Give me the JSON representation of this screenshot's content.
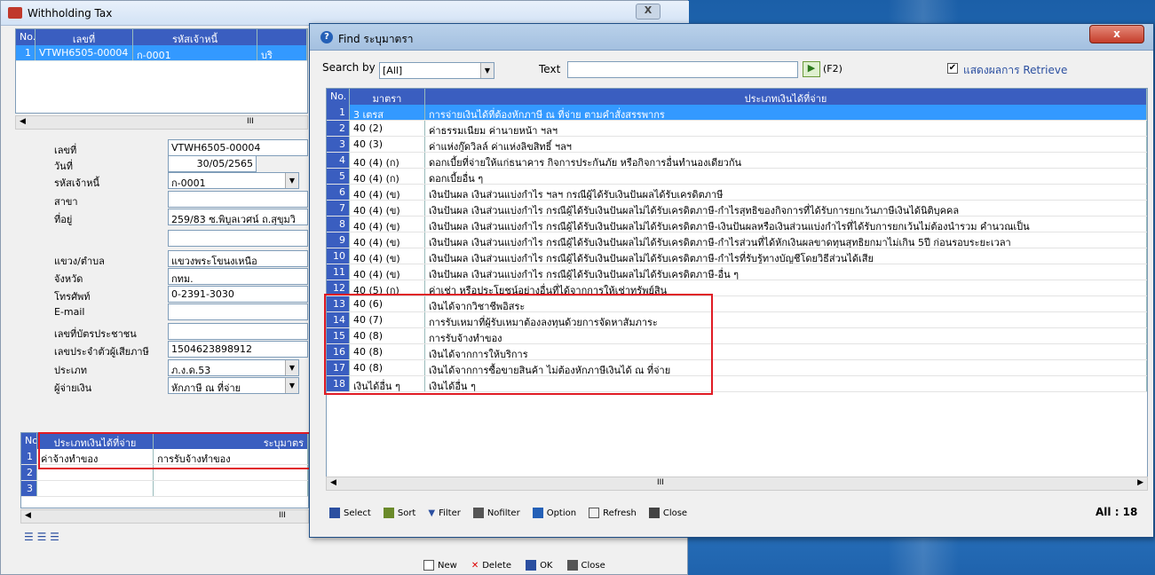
{
  "back": {
    "title": "Withholding Tax",
    "close": "X",
    "list_headers": {
      "no": "No.",
      "doc": "เลขที่",
      "creditor": "รหัสเจ้าหนี้"
    },
    "list_row": {
      "no": "1",
      "doc": "VTWH6505-00004",
      "creditor": "ก-0001",
      "extra": "บริ"
    },
    "scroll_mark": "III",
    "fields": [
      {
        "label": "เลขที่",
        "value": "VTWH6505-00004"
      },
      {
        "label": "วันที่",
        "value": "30/05/2565"
      },
      {
        "label": "รหัสเจ้าหนี้",
        "value": "ก-0001"
      },
      {
        "label": "สาขา",
        "value": ""
      },
      {
        "label": "ที่อยู่",
        "value": "259/83 ซ.พิบูลเวศน์ ถ.สุขุมวิ"
      },
      {
        "label": "",
        "value": ""
      },
      {
        "label": "แขวง/ตำบล",
        "value": "แขวงพระโขนงเหนือ"
      },
      {
        "label": "จังหวัด",
        "value": "กทม."
      },
      {
        "label": "โทรศัพท์",
        "value": "0-2391-3030"
      },
      {
        "label": "E-mail",
        "value": ""
      },
      {
        "label": "เลขที่บัตรประชาชน",
        "value": ""
      },
      {
        "label": "เลขประจำตัวผู้เสียภาษี",
        "value": "1504623898912"
      },
      {
        "label": "ประเภท",
        "value": "ภ.ง.ด.53"
      },
      {
        "label": "ผู้จ่ายเงิน",
        "value": "หักภาษี ณ ที่จ่าย"
      }
    ],
    "detail_headers": {
      "no": "No.",
      "type": "ประเภทเงินได้ที่จ่าย",
      "section": "ระบุมาตร"
    },
    "detail_rows": [
      {
        "no": "1",
        "type": "ค่าจ้างทำของ",
        "section": "การรับจ้างทำของ"
      },
      {
        "no": "2",
        "type": "",
        "section": ""
      },
      {
        "no": "3",
        "type": "",
        "section": ""
      }
    ],
    "bottom_buttons": {
      "new": "New",
      "delete": "Delete",
      "ok": "OK",
      "close": "Close"
    }
  },
  "find": {
    "title": "Find ระบุมาตรา",
    "close": "x",
    "search_by_label": "Search by",
    "search_by_value": "[All]",
    "text_label": "Text",
    "text_value": "",
    "f2": "(F2)",
    "retrieve_label": "แสดงผลการ Retrieve",
    "headers": {
      "no": "No.",
      "section": "มาตรา",
      "type": "ประเภทเงินได้ที่จ่าย"
    },
    "rows": [
      {
        "no": "1",
        "section": "3 เตรส",
        "type": "การจ่ายเงินได้ที่ต้องหักภาษี ณ ที่จ่าย ตามคำสั่งสรรพากร"
      },
      {
        "no": "2",
        "section": "40 (2)",
        "type": "ค่าธรรมเนียม ค่านายหน้า ฯลฯ"
      },
      {
        "no": "3",
        "section": "40 (3)",
        "type": "ค่าแห่งกู๊ดวิลล์ ค่าแห่งลิขสิทธิ์ ฯลฯ"
      },
      {
        "no": "4",
        "section": "40 (4) (ก)",
        "type": "ดอกเบี้ยที่จ่ายให้แก่ธนาคาร กิจการประกันภัย หรือกิจการอื่นทำนองเดียวกัน"
      },
      {
        "no": "5",
        "section": "40 (4) (ก)",
        "type": "ดอกเบี้ยอื่น ๆ"
      },
      {
        "no": "6",
        "section": "40 (4) (ข)",
        "type": "เงินปันผล เงินส่วนแบ่งกำไร ฯลฯ กรณีผู้ได้รับเงินปันผลได้รับเครดิตภาษี"
      },
      {
        "no": "7",
        "section": "40 (4) (ข)",
        "type": "เงินปันผล เงินส่วนแบ่งกำไร กรณีผู้ได้รับเงินปันผลไม่ได้รับเครดิตภาษี-กำไรสุทธิของกิจการที่ได้รับการยกเว้นภาษีเงินได้นิติบุคคล"
      },
      {
        "no": "8",
        "section": "40 (4) (ข)",
        "type": "เงินปันผล เงินส่วนแบ่งกำไร กรณีผู้ได้รับเงินปันผลไม่ได้รับเครดิตภาษี-เงินปันผลหรือเงินส่วนแบ่งกำไรที่ได้รับการยกเว้นไม่ต้องนำรวม คำนวณเป็น"
      },
      {
        "no": "9",
        "section": "40 (4) (ข)",
        "type": "เงินปันผล เงินส่วนแบ่งกำไร กรณีผู้ได้รับเงินปันผลไม่ได้รับเครดิตภาษี-กำไรส่วนที่ได้หักเงินผลขาดทุนสุทธิยกมาไม่เกิน 5ปี ก่อนรอบระยะเวลา"
      },
      {
        "no": "10",
        "section": "40 (4) (ข)",
        "type": "เงินปันผล เงินส่วนแบ่งกำไร กรณีผู้ได้รับเงินปันผลไม่ได้รับเครดิตภาษี-กำไรที่รับรู้ทางบัญชีโดยวิธีส่วนได้เสีย"
      },
      {
        "no": "11",
        "section": "40 (4) (ข)",
        "type": "เงินปันผล เงินส่วนแบ่งกำไร กรณีผู้ได้รับเงินปันผลไม่ได้รับเครดิตภาษี-อื่น ๆ"
      },
      {
        "no": "12",
        "section": "40 (5) (ก)",
        "type": "ค่าเช่า หรือประโยชน์อย่างอื่นที่ได้จากการให้เช่าทรัพย์สิน"
      },
      {
        "no": "13",
        "section": "40 (6)",
        "type": "เงินได้จากวิชาชีพอิสระ"
      },
      {
        "no": "14",
        "section": "40 (7)",
        "type": "การรับเหมาที่ผู้รับเหมาต้องลงทุนด้วยการจัดหาสัมภาระ"
      },
      {
        "no": "15",
        "section": "40 (8)",
        "type": "การรับจ้างทำของ"
      },
      {
        "no": "16",
        "section": "40 (8)",
        "type": "เงินได้จากการให้บริการ"
      },
      {
        "no": "17",
        "section": "40 (8)",
        "type": "เงินได้จากการซื้อขายสินค้า ไม่ต้องหักภาษีเงินได้ ณ ที่จ่าย"
      },
      {
        "no": "18",
        "section": "เงินได้อื่น ๆ",
        "type": "เงินได้อื่น ๆ"
      }
    ],
    "scroll_mark": "III",
    "toolbar": {
      "select": "Select",
      "sort": "Sort",
      "filter": "Filter",
      "nofilter": "Nofilter",
      "option": "Option",
      "refresh": "Refresh",
      "close": "Close"
    },
    "count": "All : 18"
  },
  "colors": {
    "header": "#3a5ec0",
    "selection": "#3399ff",
    "highlight": "#e01b24"
  }
}
